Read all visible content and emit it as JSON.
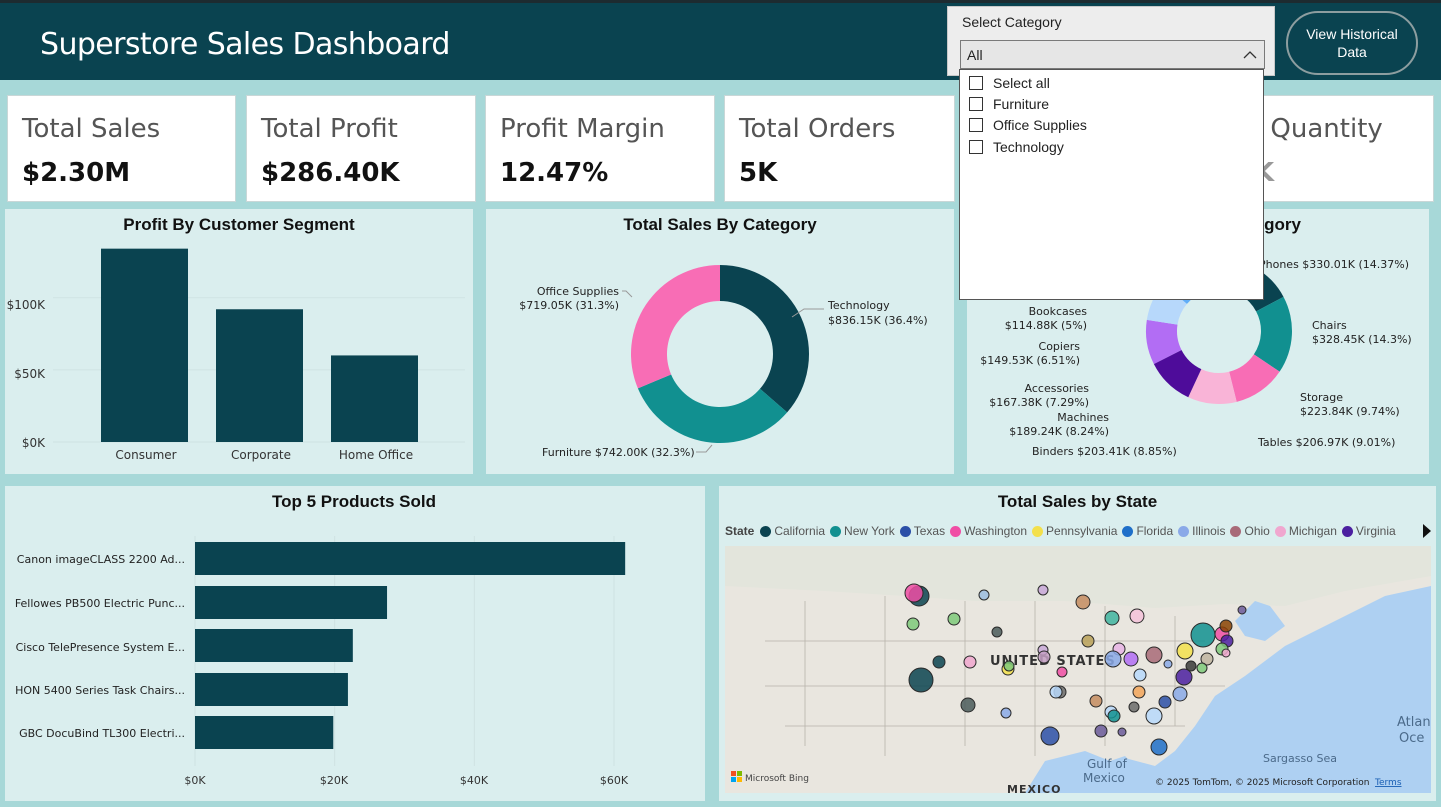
{
  "header": {
    "title": "Superstore Sales Dashboard",
    "historical_button": "View Historical Data"
  },
  "slicer": {
    "heading": "Select Category",
    "selected": "All",
    "options": [
      "Select all",
      "Furniture",
      "Office Supplies",
      "Technology"
    ]
  },
  "kpis": [
    {
      "label": "Total Sales",
      "value": "$2.30M"
    },
    {
      "label": "Total Profit",
      "value": "$286.40K"
    },
    {
      "label": "Profit Margin",
      "value": "12.47%"
    },
    {
      "label": "Total Orders",
      "value": "5K"
    },
    {
      "label": "al Quantity",
      "value": "K"
    }
  ],
  "colors": {
    "primary": "#0a4350",
    "teal": "#119090",
    "pink": "#f86db5",
    "panel": "#daeeee",
    "background": "#a7d8d8"
  },
  "profit_segment": {
    "title": "Profit By Customer Segment",
    "yticks": [
      "$100K",
      "$50K",
      "$0K"
    ]
  },
  "sales_category": {
    "title": "Total Sales By Category"
  },
  "subcategory": {
    "title_visible": "tegory",
    "labels": [
      "Phones $330.01K (14.37%)",
      "Chairs",
      "$328.45K (14.3%)",
      "Storage",
      "$223.84K (9.74%)",
      "Tables $206.97K (9.01%)",
      "Binders $203.41K (8.85%)",
      "Machines",
      "$189.24K (8.24%)",
      "Accessories",
      "$167.38K (7.29%)",
      "Copiers",
      "$149.53K (6.51%)",
      "Bookcases",
      "$114.88K (5%)"
    ]
  },
  "top_products": {
    "title": "Top 5 Products Sold",
    "xticks": [
      "$0K",
      "$20K",
      "$40K",
      "$60K"
    ]
  },
  "state_map": {
    "title": "Total Sales by State",
    "legend_label": "State",
    "legend": [
      {
        "name": "California",
        "color": "#0a4350"
      },
      {
        "name": "New York",
        "color": "#119090"
      },
      {
        "name": "Texas",
        "color": "#2b4fa7"
      },
      {
        "name": "Washington",
        "color": "#f04ea5"
      },
      {
        "name": "Pennsylvania",
        "color": "#f3e04c"
      },
      {
        "name": "Florida",
        "color": "#1e6fc9"
      },
      {
        "name": "Illinois",
        "color": "#8aa9e8"
      },
      {
        "name": "Ohio",
        "color": "#a86a78"
      },
      {
        "name": "Michigan",
        "color": "#f0a7cf"
      },
      {
        "name": "Virginia",
        "color": "#4b1fa0"
      }
    ],
    "map_texts": {
      "country": "UNITED STATES",
      "mexico": "MEXICO",
      "gulf": "Gulf of Mexico",
      "sargasso": "Sargasso Sea",
      "atlantic": "Atlan Oce",
      "bing": "Microsoft Bing",
      "copyright": "© 2025 TomTom, © 2025 Microsoft Corporation",
      "terms": "Terms"
    }
  },
  "chart_data": [
    {
      "type": "bar",
      "title": "Profit By Customer Segment",
      "categories": [
        "Consumer",
        "Corporate",
        "Home Office"
      ],
      "values": [
        134000,
        92000,
        60000
      ],
      "ylim": [
        0,
        140000
      ],
      "yticks": [
        0,
        50000,
        100000
      ]
    },
    {
      "type": "pie",
      "title": "Total Sales By Category",
      "categories": [
        "Technology",
        "Furniture",
        "Office Supplies"
      ],
      "values": [
        836.15,
        742.0,
        719.05
      ],
      "labels": [
        "Technology $836.15K (36.4%)",
        "Furniture $742.00K (32.3%)",
        "Office Supplies $719.05K (31.3%)"
      ],
      "colors": [
        "#0a4350",
        "#119090",
        "#f86db5"
      ]
    },
    {
      "type": "pie",
      "title": "Total Sales By Sub-Category",
      "categories": [
        "Phones",
        "Chairs",
        "Storage",
        "Tables",
        "Binders",
        "Machines",
        "Accessories",
        "Copiers",
        "Bookcases"
      ],
      "values": [
        330.01,
        328.45,
        223.84,
        206.97,
        203.41,
        189.24,
        167.38,
        149.53,
        114.88
      ],
      "colors": [
        "#0a4350",
        "#119090",
        "#f86db5",
        "#f9b4d7",
        "#4e0c9a",
        "#b26df4",
        "#b7d8fb",
        "#60adf8",
        "#8a4304"
      ]
    },
    {
      "type": "bar",
      "title": "Top 5 Products Sold",
      "orientation": "horizontal",
      "categories": [
        "Canon imageCLASS 2200 Ad...",
        "Fellowes PB500 Electric Punc...",
        "Cisco TelePresence System E...",
        "HON 5400 Series Task Chairs...",
        "GBC DocuBind TL300 Electri..."
      ],
      "values": [
        61600,
        27500,
        22600,
        21900,
        19800
      ],
      "xlim": [
        0,
        62000
      ],
      "xticks": [
        0,
        20000,
        40000,
        60000
      ]
    }
  ]
}
